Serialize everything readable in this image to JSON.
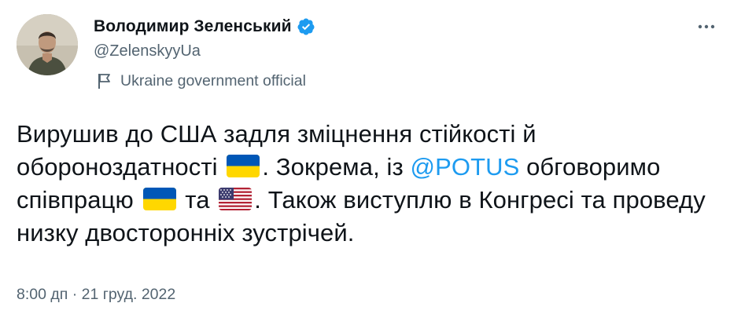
{
  "author": {
    "display_name": "Володимир Зеленський",
    "handle": "@ZelenskyyUa",
    "verified_icon": "verified-badge-icon",
    "label": "Ukraine government official",
    "label_icon": "flag-icon"
  },
  "tweet": {
    "segments": {
      "part1": "Вирушив до США задля зміцнення стійкості й обороноздатності",
      "part2": ". Зокрема, із",
      "mention": "@POTUS",
      "part3": "обговоримо співпрацю",
      "part4": "та",
      "part5": ". Також виступлю в Конгресі та проведу низку двосторонніх зустрічей."
    },
    "emoji": [
      "ukraine-flag-emoji",
      "ukraine-flag-emoji",
      "usa-flag-emoji"
    ]
  },
  "meta": {
    "time": "8:00 дп",
    "separator": "·",
    "date": "21 груд. 2022"
  },
  "colors": {
    "text": "#0f1419",
    "secondary": "#536471",
    "link": "#1d9bf0",
    "verified": "#1d9bf0",
    "ua_blue": "#0057b7",
    "ua_yellow": "#ffd700"
  },
  "icons": {
    "more": "more-dots-icon"
  }
}
